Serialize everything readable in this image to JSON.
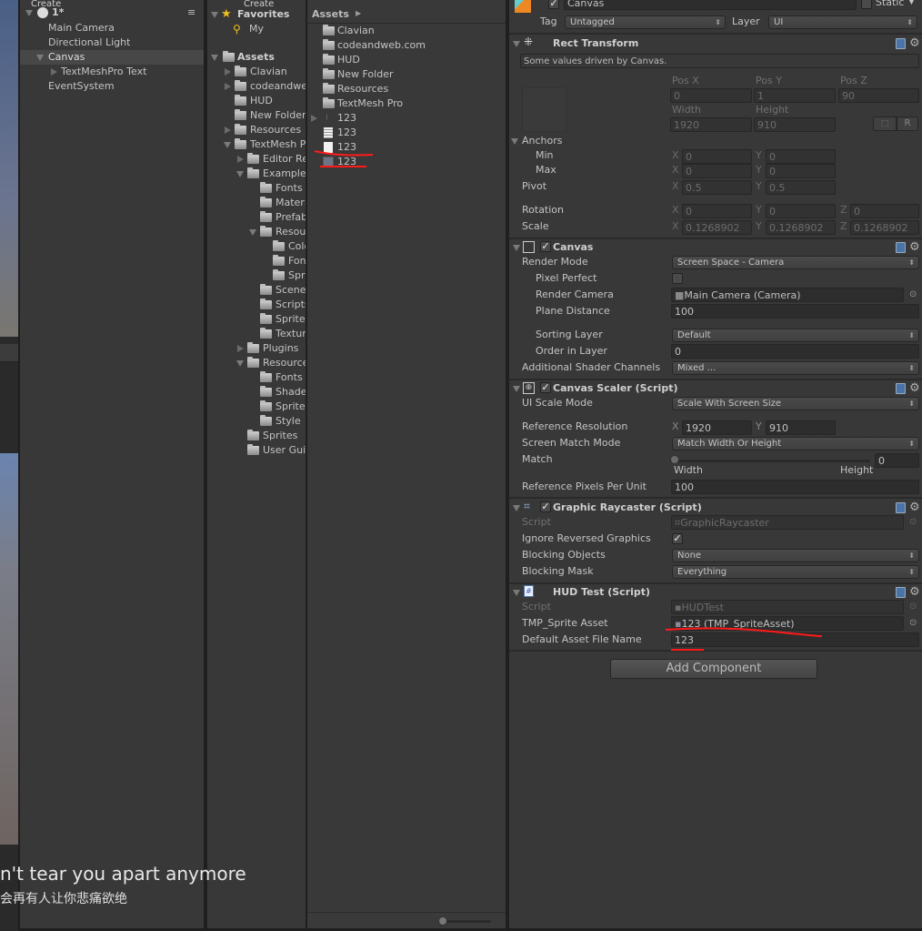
{
  "game_view": {
    "subtitle_en": "n't tear you apart anymore",
    "subtitle_zh": "会再有人让你悲痛欲绝"
  },
  "hierarchy": {
    "create_label": "Create",
    "scene": "1*",
    "items": [
      "Main Camera",
      "Directional Light",
      "Canvas",
      "TextMeshPro Text",
      "EventSystem"
    ],
    "selected": "Canvas"
  },
  "project": {
    "create_label": "Create",
    "favorites": "Favorites",
    "fav_search": "My",
    "assets_root": "Assets",
    "tree": [
      "Clavian",
      "codeandweb.com",
      "HUD",
      "New Folder",
      "Resources",
      "TextMesh Pro",
      "Editor Resources",
      "Examples",
      "Fonts",
      "Materials",
      "Prefabs",
      "Resources",
      "Color",
      "Fonts",
      "Sprites",
      "Scenes",
      "Scripts",
      "Sprites",
      "Textures",
      "Plugins",
      "Resources",
      "Fonts",
      "Shaders",
      "Sprites",
      "Style",
      "Sprites",
      "User Guide"
    ],
    "breadcrumb": "Assets",
    "files": [
      "Clavian",
      "codeandweb.com",
      "HUD",
      "New Folder",
      "Resources",
      "TextMesh Pro",
      "123",
      "123",
      "123",
      "123"
    ]
  },
  "inspector": {
    "object_name": "Canvas",
    "static_label": "Static",
    "tag_label": "Tag",
    "tag_value": "Untagged",
    "layer_label": "Layer",
    "layer_value": "UI",
    "rect_transform": {
      "title": "Rect Transform",
      "info": "Some values driven by Canvas.",
      "pos_x_label": "Pos X",
      "pos_y_label": "Pos Y",
      "pos_z_label": "Pos Z",
      "pos_x": "0",
      "pos_y": "1",
      "pos_z": "90",
      "width_label": "Width",
      "height_label": "Height",
      "width": "1920",
      "height": "910",
      "r_button": "R",
      "anchors_label": "Anchors",
      "min_label": "Min",
      "max_label": "Max",
      "min_x": "0",
      "min_y": "0",
      "max_x": "0",
      "max_y": "0",
      "pivot_label": "Pivot",
      "pivot_x": "0.5",
      "pivot_y": "0.5",
      "rotation_label": "Rotation",
      "rot_x": "0",
      "rot_y": "0",
      "rot_z": "0",
      "scale_label": "Scale",
      "scale_x": "0.1268902",
      "scale_y": "0.1268902",
      "scale_z": "0.1268902",
      "x": "X",
      "y": "Y",
      "z": "Z"
    },
    "canvas": {
      "title": "Canvas",
      "render_mode_label": "Render Mode",
      "render_mode": "Screen Space - Camera",
      "pixel_perfect_label": "Pixel Perfect",
      "pixel_perfect": false,
      "render_camera_label": "Render Camera",
      "render_camera": "Main Camera (Camera)",
      "plane_distance_label": "Plane Distance",
      "plane_distance": "100",
      "sorting_layer_label": "Sorting Layer",
      "sorting_layer": "Default",
      "order_label": "Order in Layer",
      "order": "0",
      "shader_channels_label": "Additional Shader Channels",
      "shader_channels": "Mixed ..."
    },
    "canvas_scaler": {
      "title": "Canvas Scaler (Script)",
      "scale_mode_label": "UI Scale Mode",
      "scale_mode": "Scale With Screen Size",
      "ref_res_label": "Reference Resolution",
      "ref_x": "1920",
      "ref_y": "910",
      "match_mode_label": "Screen Match Mode",
      "match_mode": "Match Width Or Height",
      "match_label": "Match",
      "match": "0",
      "match_left": "Width",
      "match_right": "Height",
      "ppu_label": "Reference Pixels Per Unit",
      "ppu": "100"
    },
    "graphic_raycaster": {
      "title": "Graphic Raycaster (Script)",
      "script_label": "Script",
      "script": "GraphicRaycaster",
      "ignore_reversed_label": "Ignore Reversed Graphics",
      "ignore_reversed": true,
      "blocking_objects_label": "Blocking Objects",
      "blocking_objects": "None",
      "blocking_mask_label": "Blocking Mask",
      "blocking_mask": "Everything"
    },
    "hud_test": {
      "title": "HUD Test (Script)",
      "script_label": "Script",
      "script": "HUDTest",
      "sprite_asset_label": "TMP_Sprite Asset",
      "sprite_asset": "123 (TMP_SpriteAsset)",
      "file_name_label": "Default Asset File Name",
      "file_name": "123"
    },
    "add_component": "Add Component"
  },
  "colors": {
    "panel": "#383838",
    "selected": "#474747",
    "annotation": "#ff1a1a",
    "help": "#4a73a8"
  }
}
